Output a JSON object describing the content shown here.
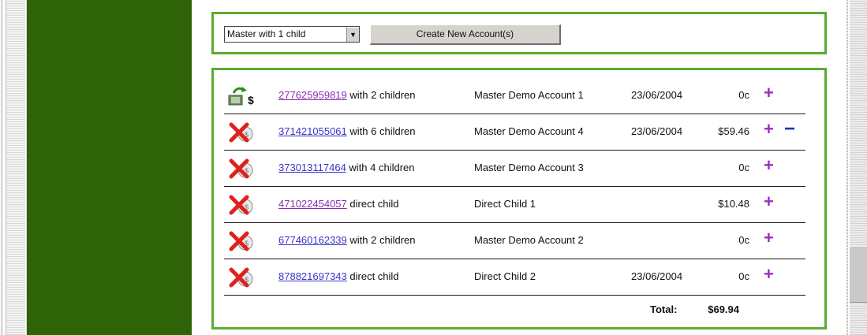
{
  "toolbar": {
    "select_value": "Master with 1 child",
    "create_label": "Create New Account(s)"
  },
  "accounts": [
    {
      "number": "277625959819",
      "relation": "with 2 children",
      "name": "Master Demo Account 1",
      "date": "23/06/2004",
      "amount": "0c",
      "icon": "money-transfer-icon",
      "has_minus": false,
      "visited": true
    },
    {
      "number": "371421055061",
      "relation": "with 6 children",
      "name": "Master Demo Account 4",
      "date": "23/06/2004",
      "amount": "$59.46",
      "icon": "cancelled-account-icon",
      "has_minus": true,
      "visited": false
    },
    {
      "number": "373013117464",
      "relation": "with 4 children",
      "name": "Master Demo Account 3",
      "date": "",
      "amount": "0c",
      "icon": "cancelled-account-icon",
      "has_minus": false,
      "visited": false
    },
    {
      "number": "471022454057",
      "relation": "direct child",
      "name": "Direct Child 1",
      "date": "",
      "amount": "$10.48",
      "icon": "cancelled-account-icon",
      "has_minus": false,
      "visited": true
    },
    {
      "number": "677460162339",
      "relation": "with 2 children",
      "name": "Master Demo Account 2",
      "date": "",
      "amount": "0c",
      "icon": "cancelled-account-icon",
      "has_minus": false,
      "visited": false
    },
    {
      "number": "878821697343",
      "relation": "direct child",
      "name": "Direct Child 2",
      "date": "23/06/2004",
      "amount": "0c",
      "icon": "cancelled-account-icon",
      "has_minus": false,
      "visited": false
    }
  ],
  "total": {
    "label": "Total:",
    "value": "$69.94"
  },
  "symbols": {
    "plus": "+",
    "minus": "−"
  },
  "colors": {
    "sidebar": "#2f6308",
    "box_border": "#5aad2e",
    "plus": "#9a2fbf",
    "minus": "#1e2fbf"
  }
}
